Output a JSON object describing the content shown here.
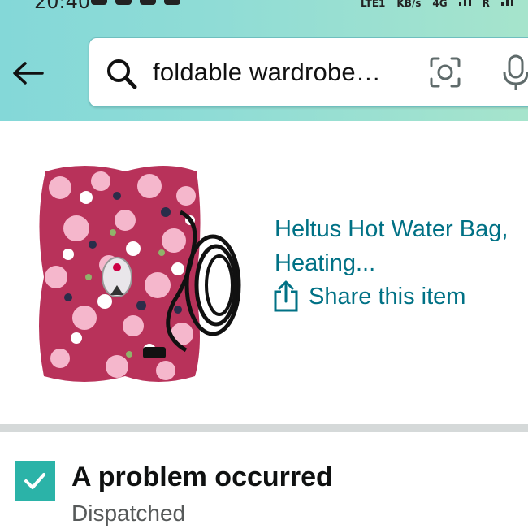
{
  "status_bar": {
    "time": "20:40",
    "network": "LTE1",
    "speed_unit": "KB/s",
    "type": "4G",
    "roaming": "R"
  },
  "search": {
    "query": "foldable wardrobe…"
  },
  "icons": {
    "back": "arrow-left-icon",
    "search": "search-icon",
    "camera": "camera-lens-icon",
    "mic": "microphone-icon",
    "share": "share-icon",
    "check": "checkmark-icon"
  },
  "product": {
    "title_line1": "Heltus Hot Water Bag,",
    "title_line2": "Heating...",
    "share_label": "Share this item"
  },
  "order_status": {
    "title": "A problem occurred",
    "subtitle": "Dispatched"
  },
  "colors": {
    "header_gradient_start": "#84d8d8",
    "header_gradient_end": "#a6e4cc",
    "link": "#007185",
    "check_bg": "#2bb3a8",
    "divider": "#d5d9d9"
  }
}
